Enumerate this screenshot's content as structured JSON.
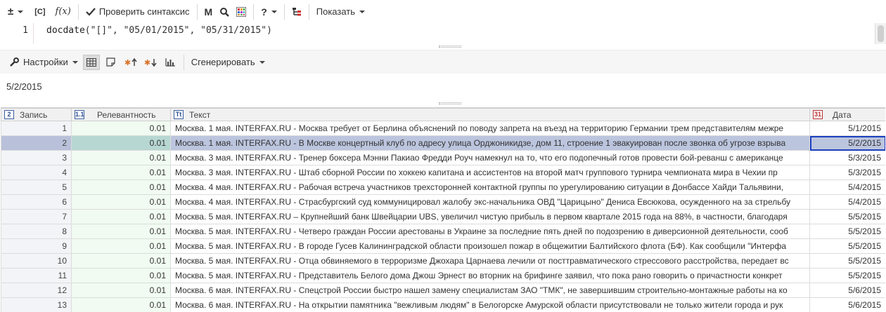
{
  "toolbar": {
    "plusminus_label": "±",
    "bracket_c_label": "[C]",
    "fx_label": "f(x)",
    "check_syntax_label": "Проверить синтаксис",
    "m_label": "M",
    "help_label": "?",
    "show_label": "Показать"
  },
  "editor": {
    "line_number": "1",
    "code_fn": "docdate",
    "code_args": "(\"[]\", \"05/01/2015\", \"05/31/2015\")"
  },
  "toolbar2": {
    "settings_label": "Настройки",
    "generate_label": "Сгенерировать"
  },
  "result": {
    "value": "5/2/2015"
  },
  "table": {
    "headers": {
      "record": "Запись",
      "relevance": "Релевантность",
      "text": "Текст",
      "date": "Дата"
    },
    "header_icons": {
      "record": "2",
      "relevance": "1.1",
      "text": "Tt",
      "date": "31"
    },
    "selected_row": 2,
    "rows": [
      {
        "record": "1",
        "relevance": "0.01",
        "text": "Москва. 1 мая. INTERFAX.RU - Москва требует от Берлина объяснений по поводу запрета на въезд на территорию Германии трем представителям межре",
        "date": "5/1/2015"
      },
      {
        "record": "2",
        "relevance": "0.01",
        "text": "Москва. 1 мая. INTERFAX.RU - В Москве концертный клуб по адресу улица Орджоникидзе, дом 11, строение 1 эвакуирован после звонка об угрозе взрыва",
        "date": "5/2/2015"
      },
      {
        "record": "3",
        "relevance": "0.01",
        "text": "Москва. 3 мая. INTERFAX.RU - Тренер боксера Мэнни Пакиао Фредди Роуч намекнул на то, что его подопечный готов провести бой-реванш с американце",
        "date": "5/3/2015"
      },
      {
        "record": "4",
        "relevance": "0.01",
        "text": "Москва. 3 мая. INTERFAX.RU - Штаб сборной России по хоккею капитана и ассистентов на второй матч группового турнира чемпионата мира в Чехии пр",
        "date": "5/3/2015"
      },
      {
        "record": "5",
        "relevance": "0.01",
        "text": "Москва. 4 мая. INTERFAX.RU - Рабочая встреча участников трехсторонней контактной группы по урегулированию ситуации в Донбассе Хайди Тальявини,",
        "date": "5/4/2015"
      },
      {
        "record": "6",
        "relevance": "0.01",
        "text": "Москва. 4 мая. INTERFAX.RU - Страсбургский суд коммуницировал жалобу экс-начальника ОВД \"Царицыно\" Дениса Евсюкова, осужденного на за стрельбу",
        "date": "5/4/2015"
      },
      {
        "record": "7",
        "relevance": "0.01",
        "text": "Москва. 5 мая. INTERFAX.RU – Крупнейший банк Швейцарии UBS, увеличил чистую прибыль в первом квартале 2015 года на 88%, в частности, благодаря",
        "date": "5/5/2015"
      },
      {
        "record": "8",
        "relevance": "0.01",
        "text": "Москва. 5 мая. INTERFAX.RU - Четверо граждан России арестованы в Украине за последние пять дней по подозрению в диверсионной деятельности, сооб",
        "date": "5/5/2015"
      },
      {
        "record": "9",
        "relevance": "0.01",
        "text": "Москва. 5 мая. INTERFAX.RU - В городе Гусев Калининградской области произошел пожар в общежитии Балтийского флота (БФ). Как сообщили \"Интерфа",
        "date": "5/5/2015"
      },
      {
        "record": "10",
        "relevance": "0.01",
        "text": "Москва. 5 мая. INTERFAX.RU - Отца обвиняемого в терроризме Джохара Царнаева лечили от посттравматического стрессового расстройства, передает вс",
        "date": "5/5/2015"
      },
      {
        "record": "11",
        "relevance": "0.01",
        "text": "Москва. 5 мая. INTERFAX.RU - Представитель Белого дома Джош Эрнест во вторник на брифинге заявил, что пока рано говорить о причастности конкрет",
        "date": "5/5/2015"
      },
      {
        "record": "12",
        "relevance": "0.01",
        "text": "Москва. 6 мая. INTERFAX.RU - Спецстрой России быстро нашел замену специалистам ЗАО \"ТМК\", не завершившим строительно-монтажные работы на ко",
        "date": "5/6/2015"
      },
      {
        "record": "13",
        "relevance": "0.01",
        "text": "Москва. 6 мая. INTERFAX.RU - На открытии памятника \"вежливым людям\" в Белогорске Амурской области присутствовали не только жители города и рук",
        "date": "5/6/2015"
      }
    ]
  }
}
